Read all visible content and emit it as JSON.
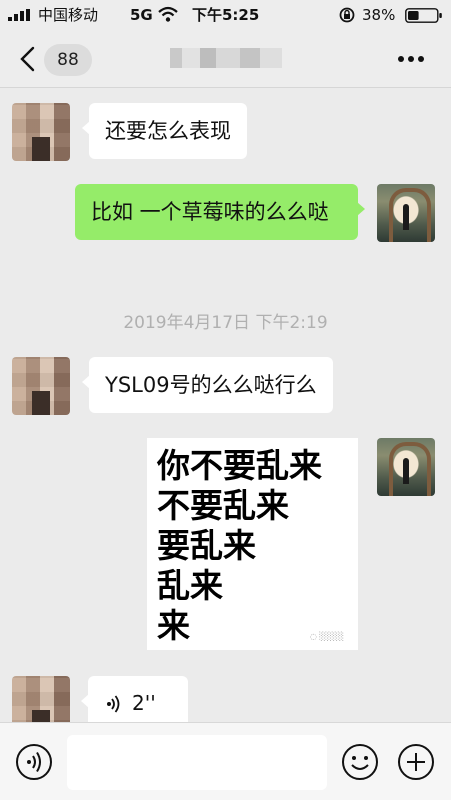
{
  "status_bar": {
    "carrier": "中国移动",
    "network": "5G",
    "time": "下午5:25",
    "battery_percent": "38%",
    "battery_level": 0.38
  },
  "nav": {
    "unread_count": "88",
    "back_icon": "chevron-left-icon",
    "more_icon": "more-dots-icon"
  },
  "messages": [
    {
      "sender": "other",
      "text": "还要怎么表现"
    },
    {
      "sender": "self",
      "text": "比如 一个草莓味的么么哒"
    },
    {
      "type": "timestamp",
      "text": "2019年4月17日 下午2:19"
    },
    {
      "sender": "other",
      "text": "YSL09号的么么哒行么"
    },
    {
      "sender": "self",
      "type": "sticker",
      "lines": [
        "你不要乱来",
        "不要乱来",
        "要乱来",
        "乱来",
        "来"
      ]
    },
    {
      "sender": "other",
      "type": "voice",
      "duration": "2''"
    }
  ],
  "input_bar": {
    "placeholder": "",
    "voice_icon": "voice-icon",
    "emoji_icon": "emoji-icon",
    "plus_icon": "plus-icon"
  },
  "colors": {
    "chat_bg": "#ebebeb",
    "self_bubble": "#95ec69",
    "other_bubble": "#ffffff",
    "timestamp": "#b0b0b0"
  }
}
